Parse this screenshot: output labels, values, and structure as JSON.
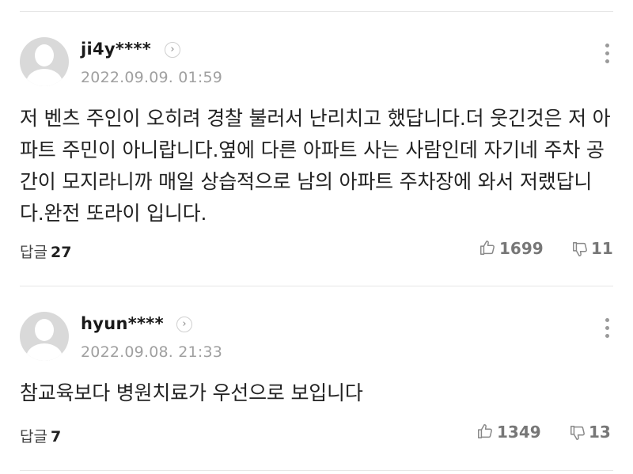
{
  "comments": [
    {
      "username": "ji4y****",
      "date": "2022.09.09. 01:59",
      "text": "저 벤츠 주인이 오히려 경찰 불러서 난리치고 했답니다.더 웃긴것은 저 아파트 주민이 아니랍니다.옆에 다른 아파트 사는 사람인데 자기네 주차 공간이 모지라니까 매일 상습적으로 남의 아파트 주차장에 와서 저랬답니다.완전 또라이 입니다.",
      "reply_label": "답글",
      "reply_count": "27",
      "likes": "1699",
      "dislikes": "11"
    },
    {
      "username": "hyun****",
      "date": "2022.09.08. 21:33",
      "text": "참교육보다 병원치료가 우선으로 보입니다",
      "reply_label": "답글",
      "reply_count": "7",
      "likes": "1349",
      "dislikes": "13"
    }
  ],
  "icons": {
    "user_link": "chevron-right-icon",
    "more": "more-vertical-icon",
    "like": "thumbs-up-icon",
    "dislike": "thumbs-down-icon"
  }
}
